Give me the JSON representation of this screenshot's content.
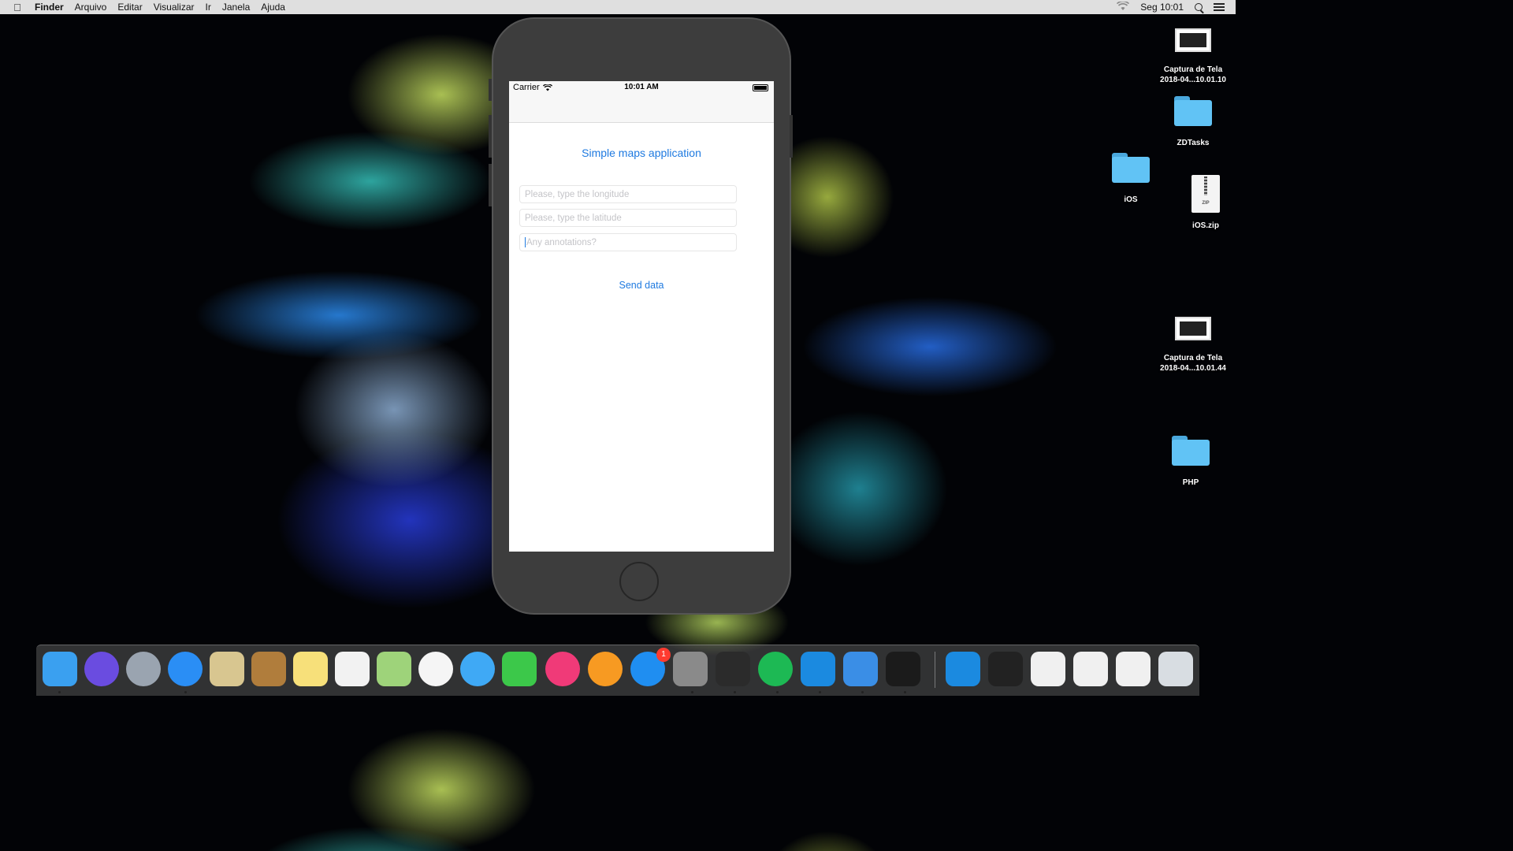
{
  "menubar": {
    "apple": "",
    "items": [
      "Finder",
      "Arquivo",
      "Editar",
      "Visualizar",
      "Ir",
      "Janela",
      "Ajuda"
    ],
    "clock": "Seg 10:01"
  },
  "simulator": {
    "statusbar": {
      "carrier": "Carrier",
      "time": "10:01 AM"
    },
    "app": {
      "title": "Simple maps application",
      "longitude_placeholder": "Please, type the longitude",
      "latitude_placeholder": "Please, type the latitude",
      "annotations_placeholder": "Any annotations?",
      "send_label": "Send data"
    }
  },
  "desktop": {
    "icons": [
      {
        "label": "Captura de Tela\n2018-04...10.01.10"
      },
      {
        "label": "ZDTasks"
      },
      {
        "label": "iOS"
      },
      {
        "label": "iOS.zip"
      },
      {
        "label": "Captura de Tela\n2018-04...10.01.44"
      },
      {
        "label": "PHP"
      }
    ]
  },
  "dock": {
    "badge": "1",
    "colors": {
      "finder": "#3aa0f0",
      "siri": "#6a4ce0",
      "launchpad": "#9aa4b0",
      "safari": "#2a8ef5",
      "mail": "#d8c690",
      "contacts": "#b07d3c",
      "notes": "#f7e07a",
      "reminders": "#f2f2f2",
      "maps": "#9ed37a",
      "photos": "#f5f5f5",
      "messages": "#3fa9f5",
      "facetime": "#3cc84a",
      "itunes": "#f03a78",
      "ibooks": "#f79a22",
      "appstore": "#1f8ef1",
      "preferences": "#8a8a8a",
      "activity": "#2b2b2b",
      "spotify": "#1db954",
      "xcode": "#1b8ae0",
      "simulator": "#3a8ee6",
      "terminal": "#1b1b1b",
      "xcode2": "#1b8ae0",
      "photobooth": "#222222",
      "preview": "#f0f0f0",
      "screenshot": "#f0f0f0",
      "window": "#f0f0f0",
      "trash": "#d8dde2"
    }
  }
}
